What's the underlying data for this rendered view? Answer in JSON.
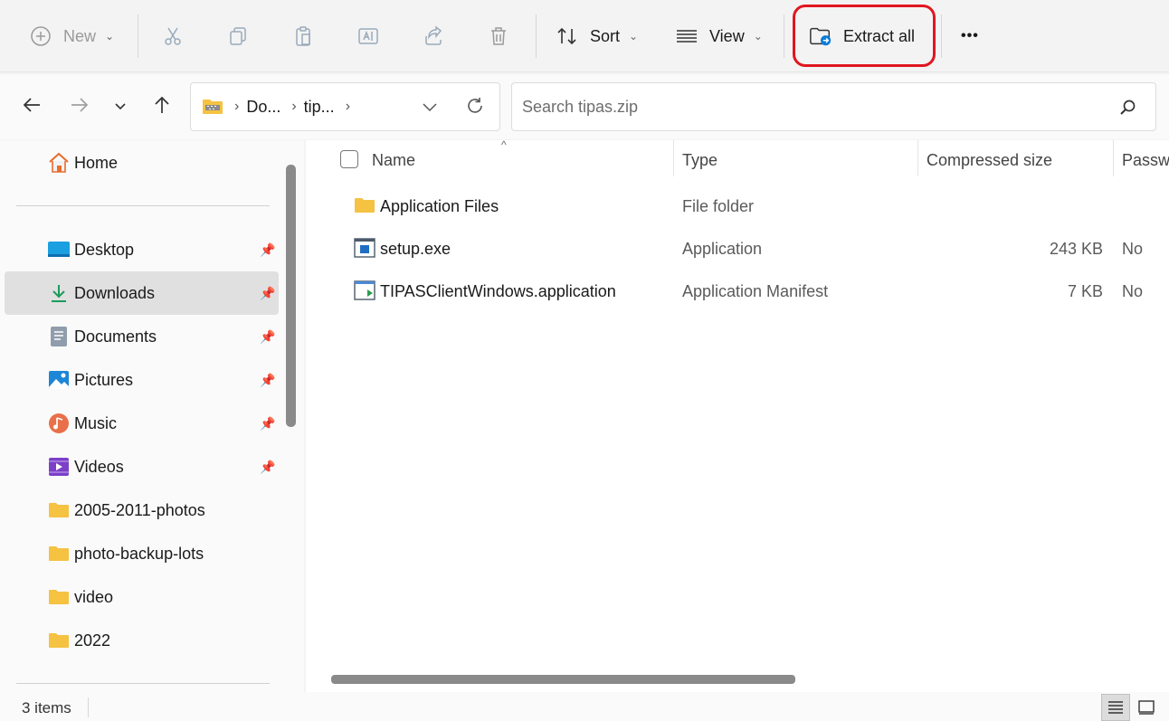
{
  "toolbar": {
    "new_label": "New",
    "sort_label": "Sort",
    "view_label": "View",
    "extract_label": "Extract all",
    "more_label": "•••"
  },
  "nav": {
    "crumbs": [
      "Do...",
      "tip..."
    ],
    "search_placeholder": "Search tipas.zip"
  },
  "sidebar": {
    "home": "Home",
    "items": [
      {
        "label": "Desktop"
      },
      {
        "label": "Downloads"
      },
      {
        "label": "Documents"
      },
      {
        "label": "Pictures"
      },
      {
        "label": "Music"
      },
      {
        "label": "Videos"
      },
      {
        "label": "2005-2011-photos"
      },
      {
        "label": "photo-backup-lots"
      },
      {
        "label": "video"
      },
      {
        "label": "2022"
      }
    ]
  },
  "columns": {
    "name": "Name",
    "type": "Type",
    "compressed": "Compressed size",
    "password": "Passwo"
  },
  "files": [
    {
      "name": "Application Files",
      "type": "File folder",
      "size": "",
      "password": ""
    },
    {
      "name": "setup.exe",
      "type": "Application",
      "size": "243 KB",
      "password": "No"
    },
    {
      "name": "TIPASClientWindows.application",
      "type": "Application Manifest",
      "size": "7 KB",
      "password": "No"
    }
  ],
  "status": {
    "items": "3 items"
  },
  "colors": {
    "highlight": "#e0161f",
    "folder": "#f5c242",
    "accent": "#0a7cd8"
  }
}
